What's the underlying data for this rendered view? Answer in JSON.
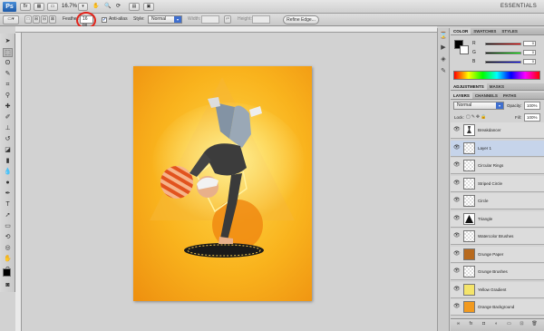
{
  "app": {
    "logo": "Ps",
    "zoom": "16.7%",
    "workspace": "ESSENTIALS"
  },
  "options": {
    "feather_label": "Feather:",
    "feather_value": "16 px",
    "antialias_label": "Anti-alias",
    "antialias_checked": true,
    "style_label": "Style:",
    "style_value": "Normal",
    "width_label": "Width:",
    "height_label": "Height:",
    "refine_button": "Refine Edge..."
  },
  "panels": {
    "color_tabs": [
      "COLOR",
      "SWATCHES",
      "STYLES"
    ],
    "channels": [
      {
        "label": "R",
        "value": "0",
        "color": "#e02020"
      },
      {
        "label": "G",
        "value": "0",
        "color": "#20b020"
      },
      {
        "label": "B",
        "value": "0",
        "color": "#2040e0"
      }
    ],
    "adjust_tabs": [
      "ADJUSTMENTS",
      "MASKS"
    ],
    "layer_tabs": [
      "LAYERS",
      "CHANNELS",
      "PATHS"
    ],
    "blend_mode": "Normal",
    "opacity_label": "Opacity:",
    "opacity_value": "100%",
    "lock_label": "Lock:",
    "fill_label": "Fill:",
    "fill_value": "100%"
  },
  "layers": [
    {
      "name": "Breakdancer",
      "selected": false,
      "thumb": "figure-icon"
    },
    {
      "name": "Layer 1",
      "selected": true,
      "thumb": "transparent"
    },
    {
      "name": "Circular Rings",
      "selected": false,
      "thumb": "transparent"
    },
    {
      "name": "Striped Circle",
      "selected": false,
      "thumb": "transparent"
    },
    {
      "name": "Circle",
      "selected": false,
      "thumb": "transparent"
    },
    {
      "name": "Triangle",
      "selected": false,
      "thumb": "triangle-icon"
    },
    {
      "name": "Watercolor Brushes",
      "selected": false,
      "thumb": "transparent"
    },
    {
      "name": "Grunge Paper",
      "selected": false,
      "thumb": "#b86a1e"
    },
    {
      "name": "Grunge Brushes",
      "selected": false,
      "thumb": "transparent"
    },
    {
      "name": "Yellow Gradient",
      "selected": false,
      "thumb": "#f4e46a"
    },
    {
      "name": "Orange Background",
      "selected": false,
      "thumb": "#f29a1e"
    }
  ],
  "colors": {
    "accent": "#e2231a",
    "selected_layer": "#c6d4ea",
    "canvas_orange": "#f9b31d"
  }
}
